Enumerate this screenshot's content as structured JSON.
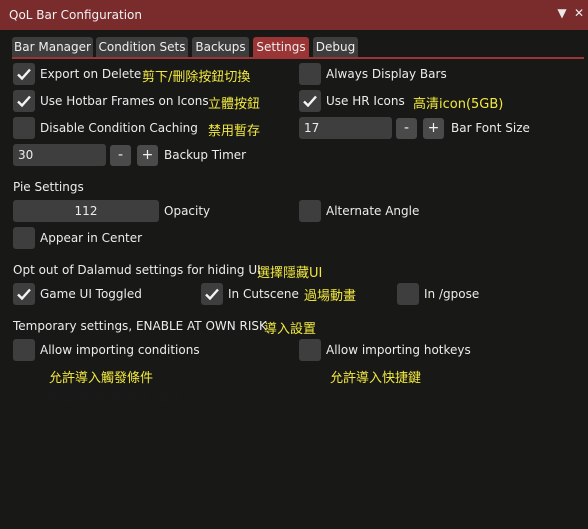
{
  "window": {
    "title": "QoL Bar Configuration"
  },
  "tabs": [
    {
      "label": "Bar Manager",
      "active": false
    },
    {
      "label": "Condition Sets",
      "active": false
    },
    {
      "label": "Backups",
      "active": false
    },
    {
      "label": "Settings",
      "active": true
    },
    {
      "label": "Debug",
      "active": false
    }
  ],
  "settings": {
    "export_on_delete": {
      "label": "Export on Delete",
      "checked": true,
      "note": "剪下/刪除按鈕切換"
    },
    "always_display_bars": {
      "label": "Always Display Bars",
      "checked": false
    },
    "use_hotbar_frames": {
      "label": "Use Hotbar Frames on Icons",
      "checked": true,
      "note": "立體按鈕"
    },
    "use_hr_icons": {
      "label": "Use HR Icons",
      "checked": true,
      "note": "高清icon(5GB)"
    },
    "disable_condition_caching": {
      "label": "Disable Condition Caching",
      "checked": false,
      "note": "禁用暫存"
    },
    "bar_font_size": {
      "label": "Bar Font Size",
      "value": "17"
    },
    "backup_timer": {
      "label": "Backup Timer",
      "value": "30"
    }
  },
  "pie": {
    "heading": "Pie Settings",
    "opacity": {
      "label": "Opacity",
      "value": "112"
    },
    "alternate_angle": {
      "label": "Alternate Angle",
      "checked": false
    },
    "appear_in_center": {
      "label": "Appear in Center",
      "checked": false
    }
  },
  "dalamud": {
    "heading": "Opt out of Dalamud settings for hiding UI",
    "note": "選擇隱藏UI",
    "game_ui_toggled": {
      "label": "Game UI Toggled",
      "checked": true
    },
    "in_cutscene": {
      "label": "In Cutscene",
      "checked": true,
      "note": "過場動畫"
    },
    "in_gpose": {
      "label": "In /gpose",
      "checked": false
    }
  },
  "temporary": {
    "heading": "Temporary settings, ENABLE AT OWN RISK",
    "note": "導入設置",
    "allow_importing_conditions": {
      "label": "Allow importing conditions",
      "checked": false,
      "note": "允許導入觸發條件"
    },
    "allow_importing_hotkeys": {
      "label": "Allow importing hotkeys",
      "checked": false,
      "note": "允許導入快捷鍵"
    }
  },
  "steppers": {
    "minus": "-",
    "plus": "+"
  },
  "icons": {
    "collapse": "triangle-down",
    "close": "x"
  },
  "colors": {
    "accent": "#9b3434",
    "title_bar": "#7a2b2b",
    "note": "#f2e93f"
  }
}
